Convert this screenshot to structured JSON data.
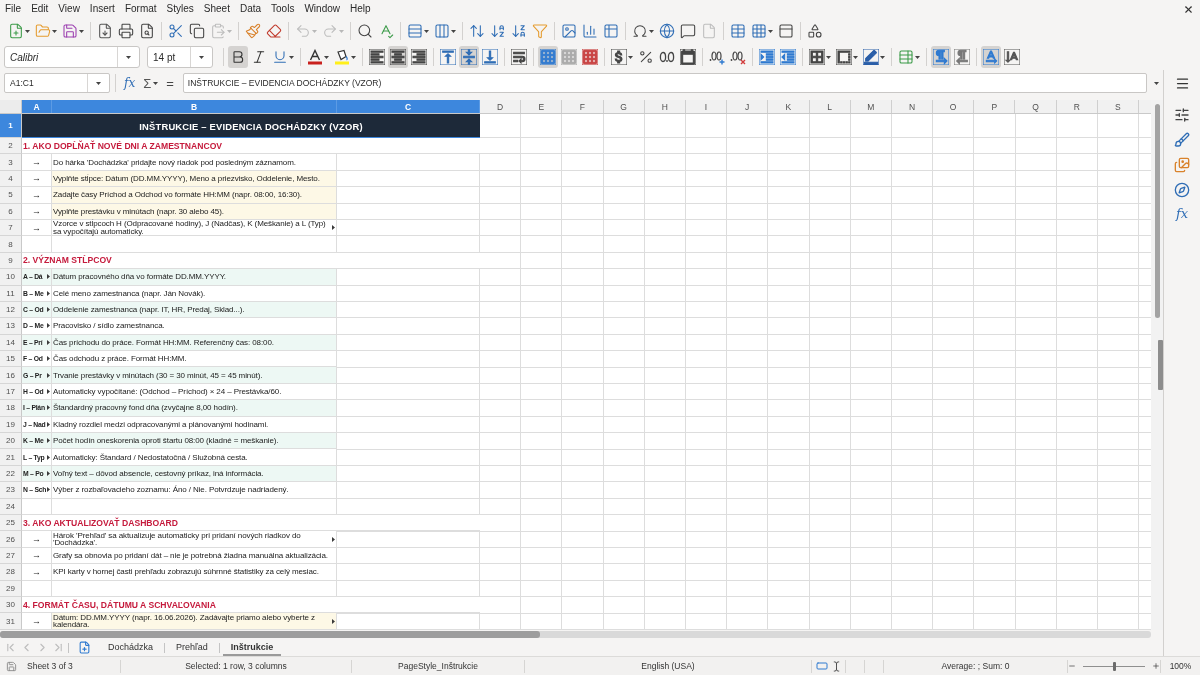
{
  "menu_bar": [
    "File",
    "Edit",
    "View",
    "Insert",
    "Format",
    "Styles",
    "Sheet",
    "Data",
    "Tools",
    "Window",
    "Help"
  ],
  "standard_toolbar": [
    [
      {
        "kind": "new",
        "disabled": false
      },
      {
        "kind": "open",
        "disabled": false
      },
      {
        "kind": "save",
        "disabled": false
      }
    ],
    [
      {
        "kind": "export_pdf",
        "disabled": false
      },
      {
        "kind": "print",
        "disabled": false
      },
      {
        "kind": "print_preview",
        "disabled": false
      }
    ],
    [
      {
        "kind": "cut",
        "disabled": false
      },
      {
        "kind": "copy",
        "disabled": false
      },
      {
        "kind": "paste",
        "disabled": true
      }
    ],
    [
      {
        "kind": "clone_formatting",
        "disabled": false
      },
      {
        "kind": "clear_formatting",
        "disabled": false
      }
    ],
    [
      {
        "kind": "undo",
        "disabled": true
      },
      {
        "kind": "redo",
        "disabled": true
      }
    ],
    [
      {
        "kind": "find_replace",
        "disabled": false
      },
      {
        "kind": "spelling",
        "disabled": false
      }
    ],
    [
      {
        "kind": "row",
        "disabled": false
      },
      {
        "kind": "column",
        "disabled": false
      }
    ],
    [
      {
        "kind": "sort",
        "disabled": false
      },
      {
        "kind": "sort_ascending",
        "disabled": false
      },
      {
        "kind": "sort_descending",
        "disabled": false
      },
      {
        "kind": "autofilter",
        "disabled": false
      }
    ],
    [
      {
        "kind": "image",
        "disabled": false
      },
      {
        "kind": "chart",
        "disabled": false
      },
      {
        "kind": "pivot_table",
        "disabled": false
      }
    ],
    [
      {
        "kind": "special_character",
        "disabled": false
      },
      {
        "kind": "hyperlink",
        "disabled": false
      },
      {
        "kind": "comment",
        "disabled": false
      },
      {
        "kind": "headers_footers",
        "disabled": true
      }
    ],
    [
      {
        "kind": "print_area",
        "disabled": false
      },
      {
        "kind": "freeze",
        "disabled": false
      },
      {
        "kind": "split_window",
        "disabled": false
      }
    ],
    [
      {
        "kind": "draw_functions",
        "disabled": false
      }
    ]
  ],
  "format_toolbar": {
    "font_name": "Calibri",
    "font_size": "14 pt",
    "groups": [
      [
        {
          "kind": "bold",
          "on": true
        },
        {
          "kind": "italic",
          "on": false
        },
        {
          "kind": "underline",
          "on": false
        }
      ],
      [
        {
          "kind": "font_color",
          "on": false
        },
        {
          "kind": "highlight",
          "on": false
        }
      ],
      [
        {
          "kind": "align_left",
          "on": false
        },
        {
          "kind": "align_center",
          "on": true
        },
        {
          "kind": "align_right",
          "on": false
        }
      ],
      [
        {
          "kind": "align_top",
          "on": false
        },
        {
          "kind": "align_middle",
          "on": true
        },
        {
          "kind": "align_bottom",
          "on": false
        }
      ],
      [
        {
          "kind": "wrap_text",
          "on": false
        }
      ],
      [
        {
          "kind": "merge_center",
          "on": true
        },
        {
          "kind": "merge_cells",
          "on": false
        },
        {
          "kind": "unmerge",
          "on": false
        }
      ],
      [
        {
          "kind": "currency",
          "on": false
        },
        {
          "kind": "percent",
          "on": false
        },
        {
          "kind": "number",
          "on": false
        },
        {
          "kind": "date",
          "on": false
        }
      ],
      [
        {
          "kind": "add_decimal",
          "on": false
        },
        {
          "kind": "delete_decimal",
          "on": false
        }
      ],
      [
        {
          "kind": "indent_increase",
          "on": false
        },
        {
          "kind": "indent_decrease",
          "on": false
        }
      ],
      [
        {
          "kind": "borders",
          "on": false
        },
        {
          "kind": "border_style",
          "on": false
        },
        {
          "kind": "border_color",
          "on": false
        }
      ],
      [
        {
          "kind": "conditional",
          "on": false
        }
      ],
      [
        {
          "kind": "ltr",
          "on": true
        },
        {
          "kind": "rtl",
          "on": false
        }
      ],
      [
        {
          "kind": "text_horizontal",
          "on": true
        },
        {
          "kind": "text_vertical",
          "on": false
        }
      ]
    ]
  },
  "formula_bar": {
    "name_box": "A1:C1",
    "function_wizard": "fx",
    "sum": "Σ",
    "equals": "=",
    "content": "INŠTRUKCIE – EVIDENCIA DOCHÁDZKY (VZOR)"
  },
  "sidebar": {
    "functions": "fx"
  },
  "sheet": {
    "columns": [
      {
        "label": "A",
        "selected": true
      },
      {
        "label": "B",
        "selected": true
      },
      {
        "label": "C",
        "selected": true
      },
      {
        "label": "D",
        "selected": false
      },
      {
        "label": "E",
        "selected": false
      },
      {
        "label": "F",
        "selected": false
      },
      {
        "label": "G",
        "selected": false
      },
      {
        "label": "H",
        "selected": false
      },
      {
        "label": "I",
        "selected": false
      },
      {
        "label": "J",
        "selected": false
      },
      {
        "label": "K",
        "selected": false
      },
      {
        "label": "L",
        "selected": false
      },
      {
        "label": "M",
        "selected": false
      },
      {
        "label": "N",
        "selected": false
      },
      {
        "label": "O",
        "selected": false
      },
      {
        "label": "P",
        "selected": false
      },
      {
        "label": "Q",
        "selected": false
      },
      {
        "label": "R",
        "selected": false
      },
      {
        "label": "S",
        "selected": false
      }
    ],
    "rows": [
      {
        "kind": "title",
        "number": "1",
        "selected": true,
        "text": "INŠTRUKCIE – EVIDENCIA DOCHÁDZKY (VZOR)"
      },
      {
        "kind": "heading",
        "number": "2",
        "selected": false,
        "text": "1. AKO DOPĹŇAŤ NOVÉ DNI A ZAMESTNANCOV"
      },
      {
        "kind": "step",
        "number": "3",
        "selected": false,
        "marker": "→",
        "text": "Do hárka 'Dochádzka' pridajte nový riadok pod posledným záznamom.",
        "shaded": false,
        "clipped": false
      },
      {
        "kind": "step",
        "number": "4",
        "selected": false,
        "marker": "→",
        "text": "Vyplňte stĺpce: Dátum (DD.MM.YYYY), Meno a priezvisko, Oddelenie, Mesto.",
        "shaded": true,
        "clipped": false
      },
      {
        "kind": "step",
        "number": "5",
        "selected": false,
        "marker": "→",
        "text": "Zadajte časy Príchod a Odchod vo formáte HH:MM (napr. 08:00, 16:30).",
        "shaded": true,
        "clipped": false
      },
      {
        "kind": "step",
        "number": "6",
        "selected": false,
        "marker": "→",
        "text": "Vyplňte prestávku v minútach (napr. 30 alebo 45).",
        "shaded": true,
        "clipped": false
      },
      {
        "kind": "step",
        "number": "7",
        "selected": false,
        "marker": "→",
        "text": "Vzorce v stĺpcoch H (Odpracované hodiny), J (Nadčas), K (Meškanie) a L (Typ) sa vypočítajú automaticky.",
        "shaded": false,
        "clipped": true
      },
      {
        "kind": "blank",
        "number": "8",
        "selected": false
      },
      {
        "kind": "heading",
        "number": "9",
        "selected": false,
        "text": "2. VÝZNAM STĹPCOV"
      },
      {
        "kind": "definition",
        "number": "10",
        "selected": false,
        "label": "A – Dá",
        "text": "Dátum pracovného dňa vo formáte DD.MM.YYYY.",
        "shaded": true,
        "clipped": true
      },
      {
        "kind": "definition",
        "number": "11",
        "selected": false,
        "label": "B – Me",
        "text": "Celé meno zamestnanca (napr. Ján Novák).",
        "shaded": false,
        "clipped": true
      },
      {
        "kind": "definition",
        "number": "12",
        "selected": false,
        "label": "C – Od",
        "text": "Oddelenie zamestnanca (napr. IT, HR, Predaj, Sklad...).",
        "shaded": true,
        "clipped": true
      },
      {
        "kind": "definition",
        "number": "13",
        "selected": false,
        "label": "D – Me",
        "text": "Pracovisko / sídlo zamestnanca.",
        "shaded": false,
        "clipped": true
      },
      {
        "kind": "definition",
        "number": "14",
        "selected": false,
        "label": "E – Prí",
        "text": "Čas príchodu do práce. Formát HH:MM. Referenčný čas: 08:00.",
        "shaded": true,
        "clipped": true
      },
      {
        "kind": "definition",
        "number": "15",
        "selected": false,
        "label": "F – Od",
        "text": "Čas odchodu z práce. Formát HH:MM.",
        "shaded": false,
        "clipped": true
      },
      {
        "kind": "definition",
        "number": "16",
        "selected": false,
        "label": "G – Pr",
        "text": "Trvanie prestávky v minútach (30 = 30 minút, 45 = 45 minút).",
        "shaded": true,
        "clipped": true
      },
      {
        "kind": "definition",
        "number": "17",
        "selected": false,
        "label": "H – Od",
        "text": "Automaticky vypočítané: (Odchod – Príchod) × 24 – Prestávka/60.",
        "shaded": false,
        "clipped": true
      },
      {
        "kind": "definition",
        "number": "18",
        "selected": false,
        "label": "I – Plán",
        "text": "Štandardný pracovný fond dňa (zvyčajne 8,00 hodín).",
        "shaded": true,
        "clipped": true
      },
      {
        "kind": "definition",
        "number": "19",
        "selected": false,
        "label": "J – Nad",
        "text": "Kladný rozdiel medzi odpracovanými a plánovanými hodinami.",
        "shaded": false,
        "clipped": true
      },
      {
        "kind": "definition",
        "number": "20",
        "selected": false,
        "label": "K – Me",
        "text": "Počet hodín oneskorenia oproti štartu 08:00 (kladné = meškanie).",
        "shaded": true,
        "clipped": true
      },
      {
        "kind": "definition",
        "number": "21",
        "selected": false,
        "label": "L – Typ",
        "text": "Automaticky: Štandard / Nedostatočná / Služobná cesta.",
        "shaded": false,
        "clipped": true
      },
      {
        "kind": "definition",
        "number": "22",
        "selected": false,
        "label": "M – Po",
        "text": "Voľný text – dôvod absencie, cestovný príkaz, iná informácia.",
        "shaded": true,
        "clipped": true
      },
      {
        "kind": "definition",
        "number": "23",
        "selected": false,
        "label": "N – Sch",
        "text": "Výber z rozbaľovacieho zoznamu: Áno / Nie. Potvrdzuje nadriadený.",
        "shaded": false,
        "clipped": true
      },
      {
        "kind": "blank",
        "number": "24",
        "selected": false
      },
      {
        "kind": "heading",
        "number": "25",
        "selected": false,
        "text": "3. AKO AKTUALIZOVAŤ DASHBOARD"
      },
      {
        "kind": "step",
        "number": "26",
        "selected": false,
        "marker": "→",
        "text": "Hárok 'Prehľad' sa aktualizuje automaticky pri pridaní nových riadkov do 'Dochádzka'.",
        "shaded": false,
        "clipped": true
      },
      {
        "kind": "step",
        "number": "27",
        "selected": false,
        "marker": "→",
        "text": "Grafy sa obnovia po pridaní dát – nie je potrebná žiadna manuálna aktualizácia.",
        "shaded": false,
        "clipped": false
      },
      {
        "kind": "step",
        "number": "28",
        "selected": false,
        "marker": "→",
        "text": "KPI karty v hornej časti prehľadu zobrazujú súhrnné štatistiky za celý mesiac.",
        "shaded": false,
        "clipped": false
      },
      {
        "kind": "blank",
        "number": "29",
        "selected": false
      },
      {
        "kind": "heading",
        "number": "30",
        "selected": false,
        "text": "4. FORMÁT ČASU, DÁTUMU A SCHVAĽOVANIA"
      },
      {
        "kind": "step",
        "number": "31",
        "selected": false,
        "marker": "→",
        "text": "Dátum: DD.MM.YYYY (napr. 16.06.2026). Zadávajte priamo alebo vyberte z kalendára.",
        "shaded": true,
        "clipped": true
      }
    ]
  },
  "sheet_tabs": [
    {
      "label": "Dochádzka",
      "selected": false
    },
    {
      "label": "Prehľad",
      "selected": false
    },
    {
      "label": "Inštrukcie",
      "selected": true
    }
  ],
  "status_bar": {
    "sheet": "Sheet 3 of 3",
    "selection": "Selected: 1 row, 3 columns",
    "page_style": "PageStyle_Inštrukcie",
    "language": "English (USA)",
    "summary": "Average: ; Sum: 0",
    "zoom_slider": {
      "level": 0.5
    },
    "zoom": "100%"
  }
}
